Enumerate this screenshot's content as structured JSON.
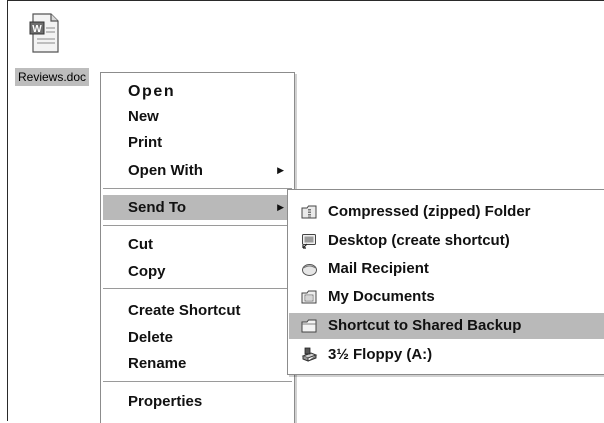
{
  "desktop": {
    "file_name": "Reviews.doc",
    "file_icon_text": "W",
    "file_icon": "word-document-icon"
  },
  "context_menu": {
    "items": [
      {
        "label": "Open"
      },
      {
        "label": "New"
      },
      {
        "label": "Print"
      },
      {
        "label": "Open With",
        "submenu": true
      },
      {
        "label": "Send To",
        "submenu": true,
        "highlighted": true
      },
      {
        "label": "Cut"
      },
      {
        "label": "Copy"
      },
      {
        "label": "Create Shortcut"
      },
      {
        "label": "Delete"
      },
      {
        "label": "Rename"
      },
      {
        "label": "Properties"
      }
    ],
    "arrow_glyph": "▶"
  },
  "send_to_menu": {
    "items": [
      {
        "label": "Compressed (zipped) Folder",
        "icon": "zip-folder-icon"
      },
      {
        "label": "Desktop (create shortcut)",
        "icon": "desktop-shortcut-icon"
      },
      {
        "label": "Mail Recipient",
        "icon": "mail-icon"
      },
      {
        "label": "My Documents",
        "icon": "my-documents-icon"
      },
      {
        "label": "Shortcut to Shared Backup",
        "icon": "folder-icon",
        "highlighted": true
      },
      {
        "label": "3½ Floppy (A:)",
        "icon": "floppy-drive-icon"
      }
    ]
  },
  "colors": {
    "highlight": "#b9b9b9",
    "menu_border": "#8c8c8c",
    "background": "#ffffff"
  }
}
